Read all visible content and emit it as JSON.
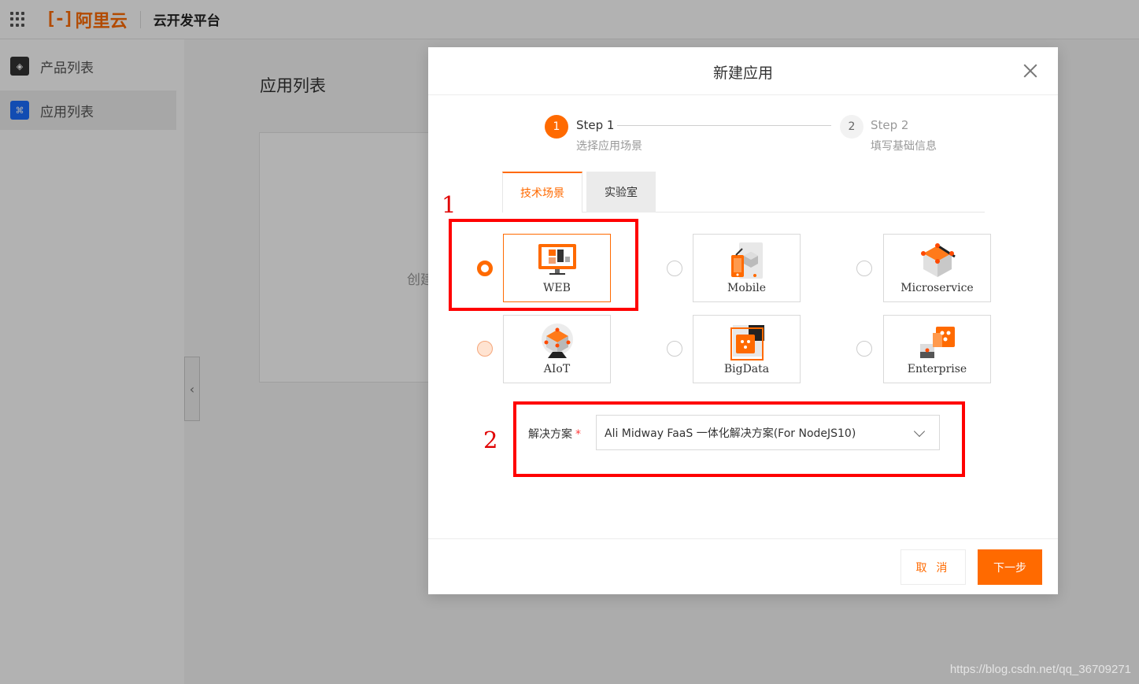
{
  "header": {
    "logo_text": "阿里云",
    "platform_name": "云开发平台"
  },
  "sidebar": {
    "items": [
      {
        "label": "产品列表",
        "active": false
      },
      {
        "label": "应用列表",
        "active": true
      }
    ]
  },
  "main": {
    "page_title": "应用列表",
    "card_text": "创建"
  },
  "dialog": {
    "title": "新建应用",
    "steps": [
      {
        "number": "1",
        "title": "Step 1",
        "desc": "选择应用场景",
        "status": "active"
      },
      {
        "number": "2",
        "title": "Step 2",
        "desc": "填写基础信息",
        "status": "pending"
      }
    ],
    "tabs": [
      {
        "label": "技术场景",
        "active": true
      },
      {
        "label": "实验室",
        "active": false
      }
    ],
    "options": [
      {
        "label": "WEB",
        "selected": true,
        "icon": "web-monitor-icon"
      },
      {
        "label": "Mobile",
        "selected": false,
        "icon": "mobile-icon"
      },
      {
        "label": "Microservice",
        "selected": false,
        "icon": "microservice-icon"
      },
      {
        "label": "AIoT",
        "selected": false,
        "icon": "aiot-icon"
      },
      {
        "label": "BigData",
        "selected": false,
        "icon": "bigdata-icon"
      },
      {
        "label": "Enterprise",
        "selected": false,
        "icon": "enterprise-icon"
      }
    ],
    "solution": {
      "label": "解决方案",
      "required_mark": "*",
      "value": "Ali Midway FaaS 一体化解决方案(For NodeJS10)"
    },
    "buttons": {
      "cancel": "取 消",
      "next": "下一步"
    }
  },
  "annotations": {
    "label_1": "1",
    "label_2": "2",
    "color": "#ff0000"
  },
  "colors": {
    "accent": "#ff6a00"
  },
  "watermark": "https://blog.csdn.net/qq_36709271"
}
